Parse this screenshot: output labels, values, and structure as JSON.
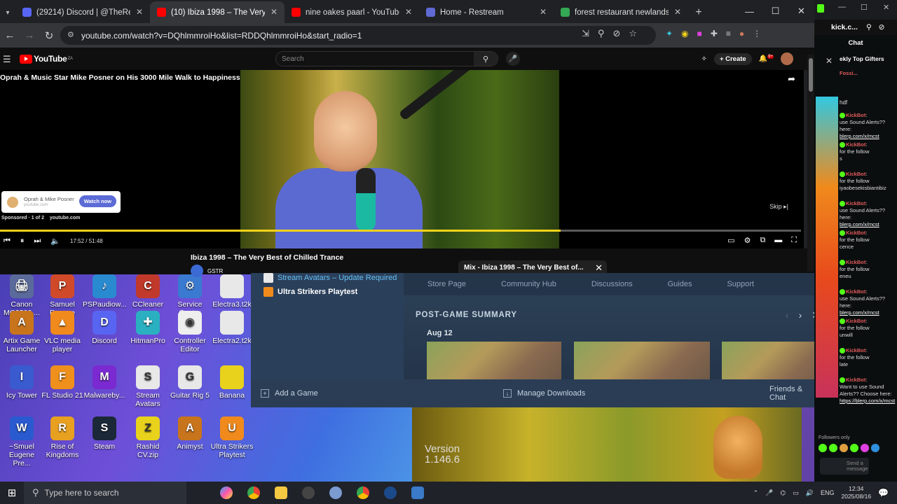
{
  "browser": {
    "tabs": [
      {
        "title": "(29214) Discord | @TheReal",
        "active": false,
        "color": "#5865f2"
      },
      {
        "title": "(10) Ibiza 1998 – The Very B",
        "active": true,
        "color": "#ff0000"
      },
      {
        "title": "nine oakes paarl - YouTube",
        "active": false,
        "color": "#ff0000"
      },
      {
        "title": "Home - Restream",
        "active": false,
        "color": "#5f6ad4"
      },
      {
        "title": "forest restaurant newlands - Go",
        "active": false,
        "color": "#34a853"
      }
    ],
    "url": "youtube.com/watch?v=DQhlmmroiHo&list=RDDQhlmmroiHo&start_radio=1"
  },
  "youtube": {
    "logo_text": "YouTube",
    "logo_sup": "ZA",
    "search_placeholder": "Search",
    "create_label": "Create",
    "notif_count": "9+",
    "video_overlay_title": "Oprah & Music Star Mike Posner on His 3000 Mile Walk to Happiness",
    "ad_channel": "Oprah & Mike Posner",
    "ad_domain": "youtube.com",
    "ad_button": "Watch now",
    "sponsored_text": "Sponsored · 1 of 2",
    "sponsored_domain": "youtube.com",
    "skip_label": "Skip",
    "time": "17:52 / 51:48",
    "progress": 0.7,
    "title": "Ibiza 1998 – The Very Best of Chilled Trance",
    "channel": "GSTR",
    "mix_title": "Mix - Ibiza 1998 – The Very Best of..."
  },
  "desktop_icons": [
    {
      "label": "Canon MG2500 ...",
      "color": "#5a6a9a",
      "glyph": "🖨"
    },
    {
      "label": "Samuel Eugene Pre...",
      "color": "#d04a2a",
      "glyph": "P"
    },
    {
      "label": "PSPaudiow...",
      "color": "#2a8ad0",
      "glyph": "♪"
    },
    {
      "label": "CCleaner",
      "color": "#c0392b",
      "glyph": "C"
    },
    {
      "label": "Service Center",
      "color": "#3a7ad0",
      "glyph": "⚙"
    },
    {
      "label": "Electra3.t2k",
      "color": "#e8e8e8",
      "glyph": ""
    },
    {
      "label": "Artix Game Launcher",
      "color": "#c8741c",
      "glyph": "A"
    },
    {
      "label": "VLC media player",
      "color": "#f08a1c",
      "glyph": "▲"
    },
    {
      "label": "Discord",
      "color": "#5865f2",
      "glyph": "D"
    },
    {
      "label": "HitmanPro",
      "color": "#2ab0c0",
      "glyph": "✚"
    },
    {
      "label": "Controller Editor",
      "color": "#eeeeee",
      "glyph": "◉"
    },
    {
      "label": "Electra2.t2k",
      "color": "#e8e8e8",
      "glyph": ""
    },
    {
      "label": "Icy Tower",
      "color": "#3a5ad0",
      "glyph": "I"
    },
    {
      "label": "FL Studio 21",
      "color": "#f0901c",
      "glyph": "F"
    },
    {
      "label": "Malwareby...",
      "color": "#7a2ad0",
      "glyph": "M"
    },
    {
      "label": "Stream Avatars",
      "color": "#e8e8e8",
      "glyph": "S"
    },
    {
      "label": "Guitar Rig 5",
      "color": "#e8e8e8",
      "glyph": "G"
    },
    {
      "label": "Banana",
      "color": "#e8d21c",
      "glyph": ""
    },
    {
      "label": "~Smuel Eugene Pre...",
      "color": "#2a5ad0",
      "glyph": "W"
    },
    {
      "label": "Rise of Kingdoms",
      "color": "#e8a020",
      "glyph": "R"
    },
    {
      "label": "Steam",
      "color": "#1b2838",
      "glyph": "S"
    },
    {
      "label": "Rashid CV.zip",
      "color": "#e8d21c",
      "glyph": "Z"
    },
    {
      "label": "Animyst",
      "color": "#c8741c",
      "glyph": "A"
    },
    {
      "label": "Ultra Strikers Playtest",
      "color": "#f08a1c",
      "glyph": "U"
    }
  ],
  "steam": {
    "library_items": [
      "Stream Avatars – Update Required",
      "Ultra Strikers Playtest"
    ],
    "nav": [
      "Store Page",
      "Community Hub",
      "Discussions",
      "Guides",
      "Support"
    ],
    "summary_title": "POST-GAME SUMMARY",
    "summary_date": "Aug 12",
    "footer_add": "Add a Game",
    "footer_downloads": "Manage Downloads",
    "footer_friends": "Friends & Chat"
  },
  "game": {
    "version_label": "Version",
    "version_number": "1.146.6"
  },
  "kick": {
    "title": "kick.c...",
    "chat_label": "Chat",
    "gifters": "ekly Top Gifters",
    "gifter_names": "Fossi...",
    "user_msg": "hdf",
    "bot_name": "KickBot",
    "messages": [
      {
        "text": "use Sound Alerts?? here:",
        "link": "blerp.com/x/mcst"
      },
      {
        "text": "for the follow",
        "extra": "s"
      },
      {
        "text": "for the follow",
        "extra": "iyaobesekisbiantibiz"
      },
      {
        "text": "use Sound Alerts?? here:",
        "link": "blerp.com/x/mcst"
      },
      {
        "text": "for the follow",
        "extra": "cence"
      },
      {
        "text": "for the follow",
        "extra": "eneu"
      },
      {
        "text": "use Sound Alerts?? here:",
        "link": "blerp.com/x/mcst"
      },
      {
        "text": "for the follow",
        "extra": "unwill"
      },
      {
        "text": "for the follow",
        "extra": "late"
      },
      {
        "text": "Want to use Sound Alerts?? Choose here:",
        "link": "https://blerp.com/x/mcst"
      }
    ],
    "followers_only": "Followers only",
    "send_placeholder": "Send a message"
  },
  "taskbar": {
    "search_placeholder": "Type here to search",
    "language": "ENG",
    "time": "12:34",
    "date": "2025/08/16"
  }
}
